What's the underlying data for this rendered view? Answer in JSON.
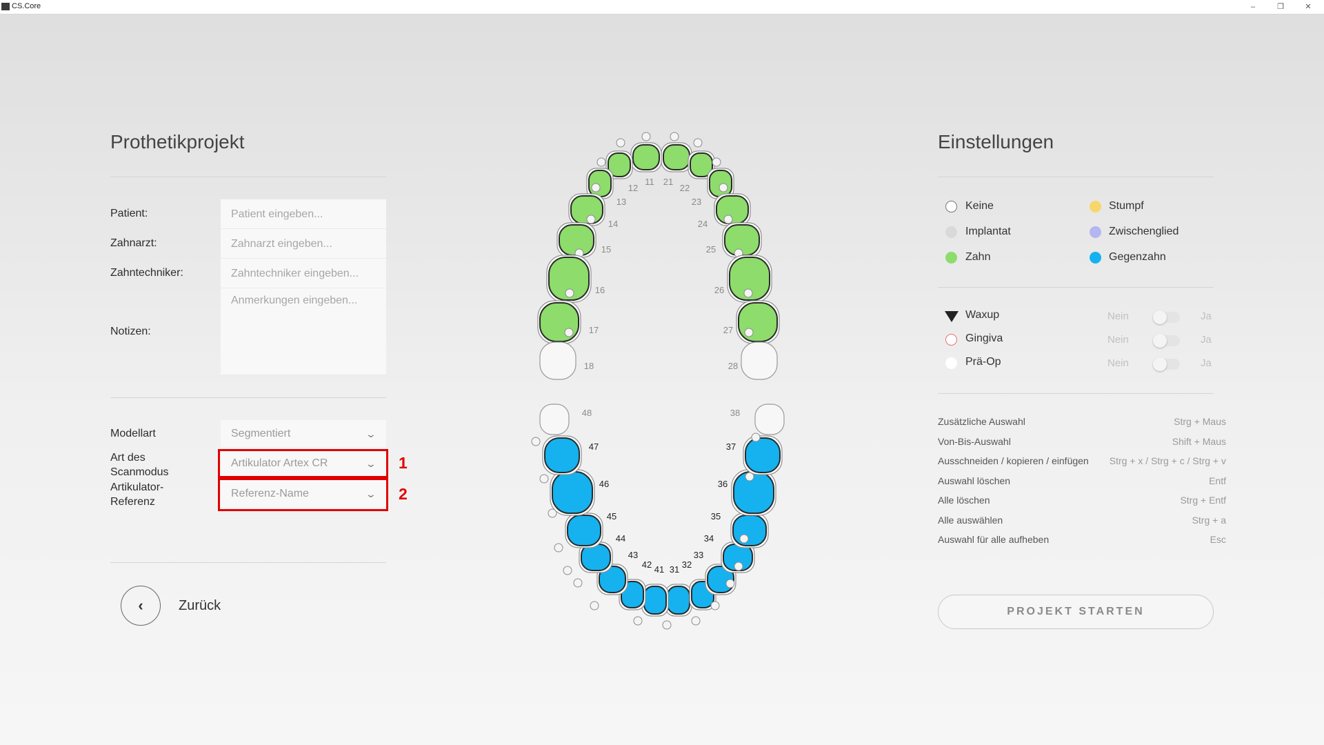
{
  "window": {
    "title": "CS.Core",
    "minimize": "–",
    "restore": "❐",
    "close": "✕"
  },
  "left": {
    "title": "Prothetikprojekt",
    "fields": {
      "patient": {
        "label": "Patient:",
        "placeholder": "Patient eingeben..."
      },
      "zahnarzt": {
        "label": "Zahnarzt:",
        "placeholder": "Zahnarzt eingeben..."
      },
      "zahntechniker": {
        "label": "Zahntechniker:",
        "placeholder": "Zahntechniker eingeben..."
      },
      "notizen": {
        "label": "Notizen:",
        "placeholder": "Anmerkungen eingeben..."
      }
    },
    "modellart": {
      "label": "Modellart",
      "value": "Segmentiert"
    },
    "scanmodus": {
      "label_1": "Art des",
      "label_2": "Scanmodus",
      "value": "Artikulator Artex CR",
      "marker": "1"
    },
    "artikulator": {
      "label_1": "Artikulator-",
      "label_2": "Referenz",
      "value": "Referenz-Name",
      "marker": "2"
    },
    "back_label": "Zurück"
  },
  "right": {
    "title": "Einstellungen",
    "legend": [
      {
        "label": "Keine",
        "color": "#ffffff"
      },
      {
        "label": "Stumpf",
        "color": "#f8d66c"
      },
      {
        "label": "Implantat",
        "color": "#d9d9d9"
      },
      {
        "label": "Zwischenglied",
        "color": "#b4b6f2"
      },
      {
        "label": "Zahn",
        "color": "#8ddc6c"
      },
      {
        "label": "Gegenzahn",
        "color": "#15b2ef"
      }
    ],
    "options": [
      {
        "label": "Waxup",
        "no": "Nein",
        "yes": "Ja",
        "icon": "waxup-triangle-icon",
        "value": false
      },
      {
        "label": "Gingiva",
        "no": "Nein",
        "yes": "Ja",
        "icon": "gingiva-circle-icon",
        "value": false
      },
      {
        "label": "Prä-Op",
        "no": "Nein",
        "yes": "Ja",
        "icon": "praeop-circle-icon",
        "value": false
      }
    ],
    "shortcuts": [
      {
        "action": "Zusätzliche Auswahl",
        "keys": "Strg + Maus"
      },
      {
        "action": "Von-Bis-Auswahl",
        "keys": "Shift + Maus"
      },
      {
        "action": "Ausschneiden / kopieren / einfügen",
        "keys": "Strg + x / Strg + c / Strg + v"
      },
      {
        "action": "Auswahl löschen",
        "keys": "Entf"
      },
      {
        "action": "Alle löschen",
        "keys": "Strg + Entf"
      },
      {
        "action": "Alle auswählen",
        "keys": "Strg + a"
      },
      {
        "action": "Auswahl für alle aufheben",
        "keys": "Esc"
      }
    ],
    "start_label": "PROJEKT STARTEN"
  },
  "dental_chart": {
    "colors": {
      "zahn": "#8ddc6c",
      "gegenzahn": "#15b2ef",
      "keine": "#f7f7f7"
    },
    "teeth": [
      {
        "number": "11",
        "state": "zahn"
      },
      {
        "number": "12",
        "state": "zahn"
      },
      {
        "number": "13",
        "state": "zahn"
      },
      {
        "number": "14",
        "state": "zahn"
      },
      {
        "number": "15",
        "state": "zahn"
      },
      {
        "number": "16",
        "state": "zahn"
      },
      {
        "number": "17",
        "state": "zahn"
      },
      {
        "number": "18",
        "state": "keine"
      },
      {
        "number": "21",
        "state": "zahn"
      },
      {
        "number": "22",
        "state": "zahn"
      },
      {
        "number": "23",
        "state": "zahn"
      },
      {
        "number": "24",
        "state": "zahn"
      },
      {
        "number": "25",
        "state": "zahn"
      },
      {
        "number": "26",
        "state": "zahn"
      },
      {
        "number": "27",
        "state": "zahn"
      },
      {
        "number": "28",
        "state": "keine"
      },
      {
        "number": "31",
        "state": "gegenzahn"
      },
      {
        "number": "32",
        "state": "gegenzahn"
      },
      {
        "number": "33",
        "state": "gegenzahn"
      },
      {
        "number": "34",
        "state": "gegenzahn"
      },
      {
        "number": "35",
        "state": "gegenzahn"
      },
      {
        "number": "36",
        "state": "gegenzahn"
      },
      {
        "number": "37",
        "state": "gegenzahn"
      },
      {
        "number": "38",
        "state": "keine"
      },
      {
        "number": "41",
        "state": "gegenzahn"
      },
      {
        "number": "42",
        "state": "gegenzahn"
      },
      {
        "number": "43",
        "state": "gegenzahn"
      },
      {
        "number": "44",
        "state": "gegenzahn"
      },
      {
        "number": "45",
        "state": "gegenzahn"
      },
      {
        "number": "46",
        "state": "gegenzahn"
      },
      {
        "number": "47",
        "state": "gegenzahn"
      },
      {
        "number": "48",
        "state": "keine"
      }
    ]
  }
}
